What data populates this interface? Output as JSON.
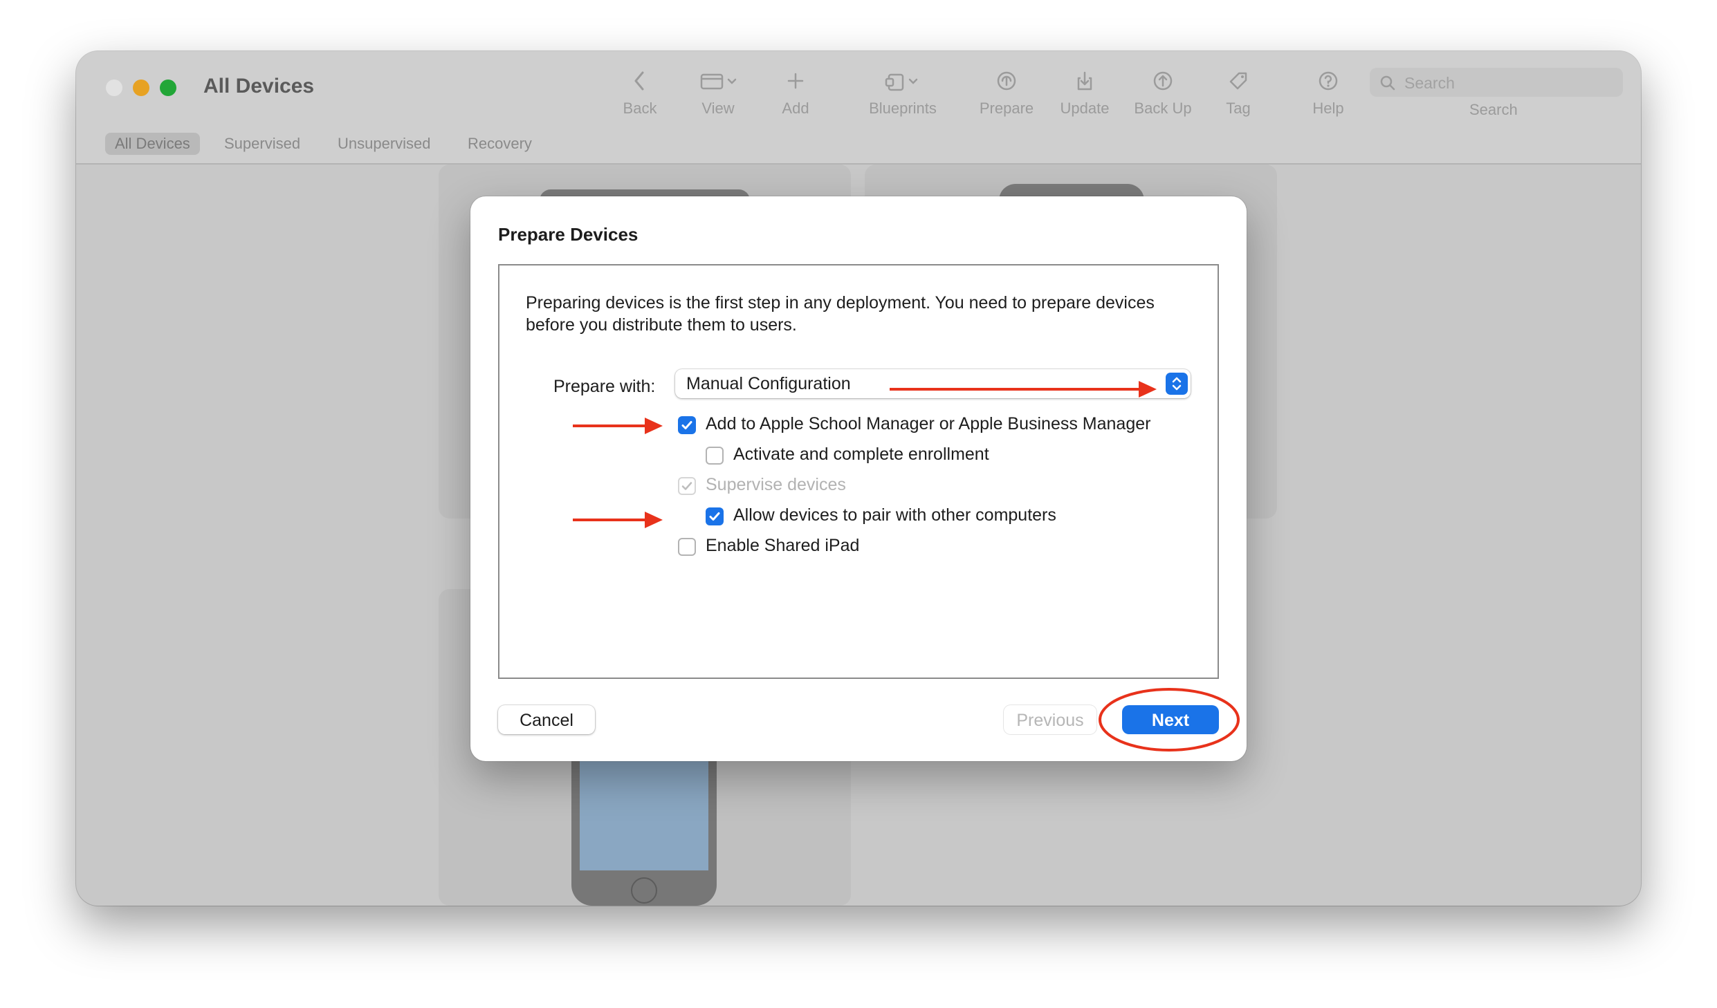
{
  "window": {
    "title": "All Devices"
  },
  "toolbar": {
    "items": [
      {
        "label": "Back",
        "icon": "chevron-left-icon"
      },
      {
        "label": "View",
        "icon": "view-icon"
      },
      {
        "label": "Add",
        "icon": "plus-icon"
      },
      {
        "label": "Blueprints",
        "icon": "blueprints-icon"
      },
      {
        "label": "Prepare",
        "icon": "prepare-icon"
      },
      {
        "label": "Update",
        "icon": "update-icon"
      },
      {
        "label": "Back Up",
        "icon": "backup-icon"
      },
      {
        "label": "Tag",
        "icon": "tag-icon"
      },
      {
        "label": "Help",
        "icon": "help-icon"
      }
    ],
    "search": {
      "placeholder": "Search",
      "label": "Search"
    }
  },
  "filters": {
    "active": "All Devices",
    "tabs": [
      "All Devices",
      "Supervised",
      "Unsupervised",
      "Recovery"
    ]
  },
  "dialog": {
    "title": "Prepare Devices",
    "description": "Preparing devices is the first step in any deployment. You need to prepare devices before you distribute them to users.",
    "prepare_with": {
      "label": "Prepare with:",
      "value": "Manual Configuration"
    },
    "options": [
      {
        "label": "Add to Apple School Manager or Apple Business Manager",
        "checked": true,
        "enabled": true
      },
      {
        "label": "Activate and complete enrollment",
        "checked": false,
        "enabled": true
      },
      {
        "label": "Supervise devices",
        "checked": true,
        "enabled": false
      },
      {
        "label": "Allow devices to pair with other computers",
        "checked": true,
        "enabled": true
      },
      {
        "label": "Enable Shared iPad",
        "checked": false,
        "enabled": true
      }
    ],
    "buttons": {
      "cancel": "Cancel",
      "previous": "Previous",
      "next": "Next"
    }
  },
  "annotations": {
    "color": "#e8321b"
  }
}
